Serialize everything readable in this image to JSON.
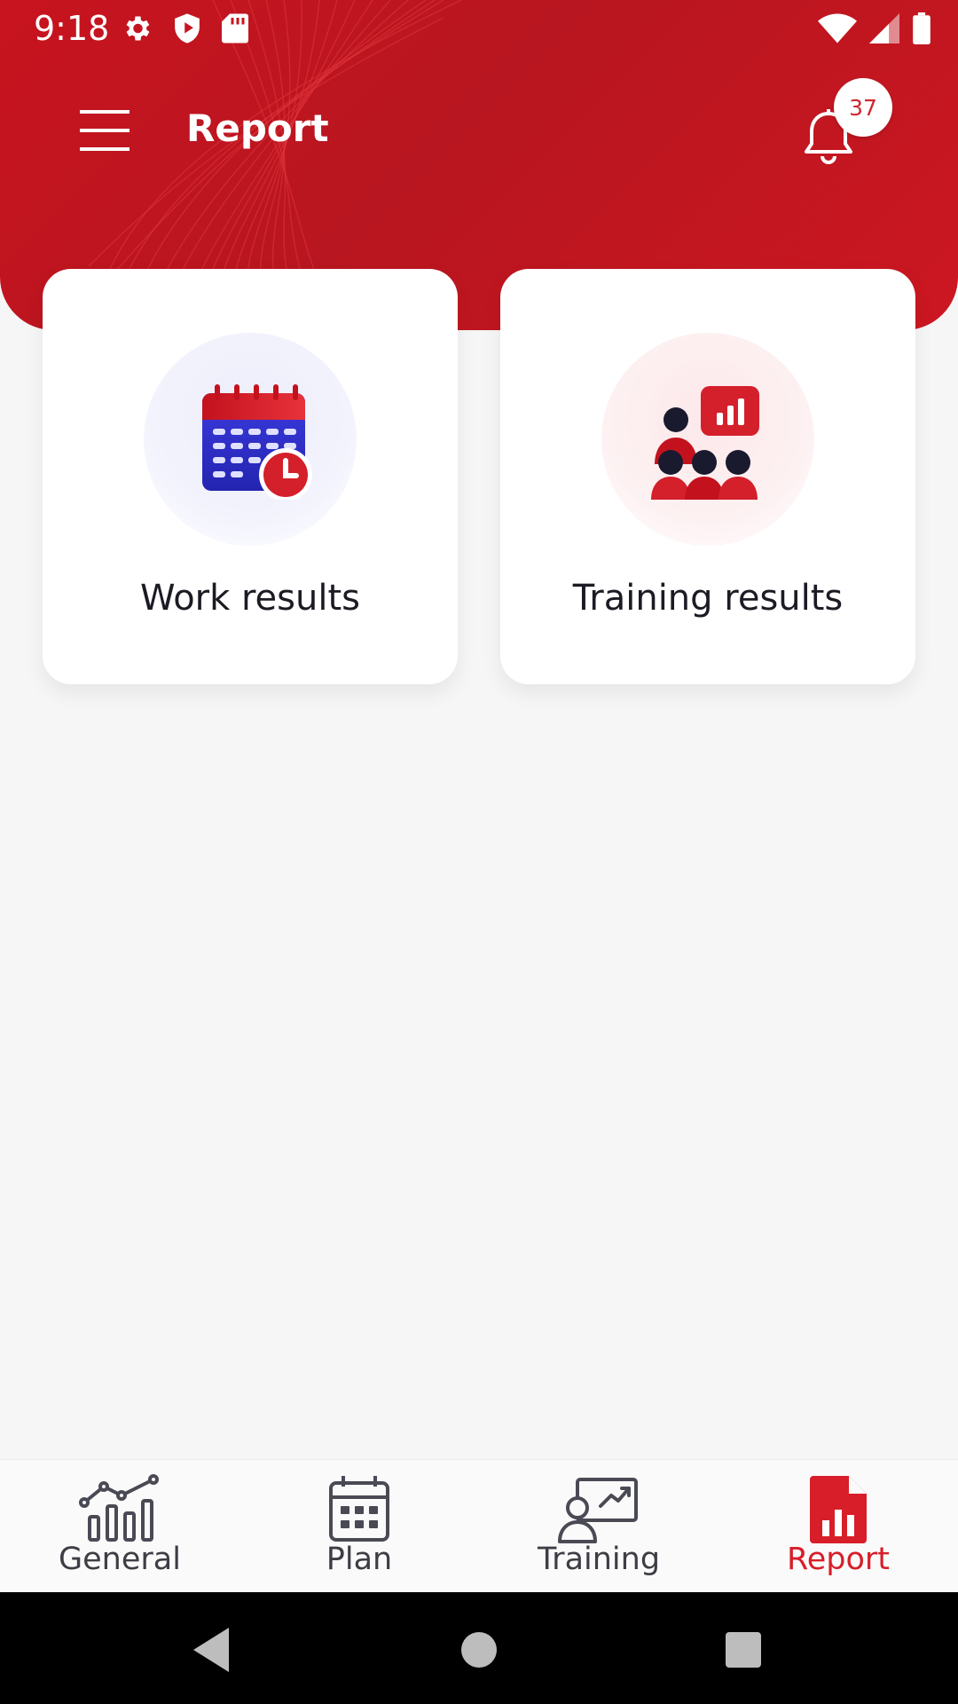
{
  "status_bar": {
    "time": "9:18",
    "left_icons": [
      "settings-icon",
      "shield-icon",
      "sd-card-icon"
    ],
    "right_icons": [
      "wifi-icon",
      "signal-icon",
      "battery-icon"
    ]
  },
  "header": {
    "title": "Report",
    "notification_count": "37",
    "menu_icon": "hamburger-menu-icon",
    "bell_icon": "bell-icon"
  },
  "cards": [
    {
      "label": "Work results",
      "icon": "calendar-clock-icon"
    },
    {
      "label": "Training results",
      "icon": "team-chart-icon"
    }
  ],
  "bottom_nav": {
    "items": [
      {
        "label": "General",
        "icon": "chart-icon"
      },
      {
        "label": "Plan",
        "icon": "calendar-icon"
      },
      {
        "label": "Training",
        "icon": "presentation-icon"
      },
      {
        "label": "Report",
        "icon": "report-document-icon"
      }
    ],
    "active_index": 3
  },
  "system_nav": [
    "back-icon",
    "home-icon",
    "recents-icon"
  ],
  "colors": {
    "brand_red": "#c8141f",
    "active_nav": "#d81e29",
    "background": "#f6f6f6",
    "badge_text": "#d12630"
  }
}
